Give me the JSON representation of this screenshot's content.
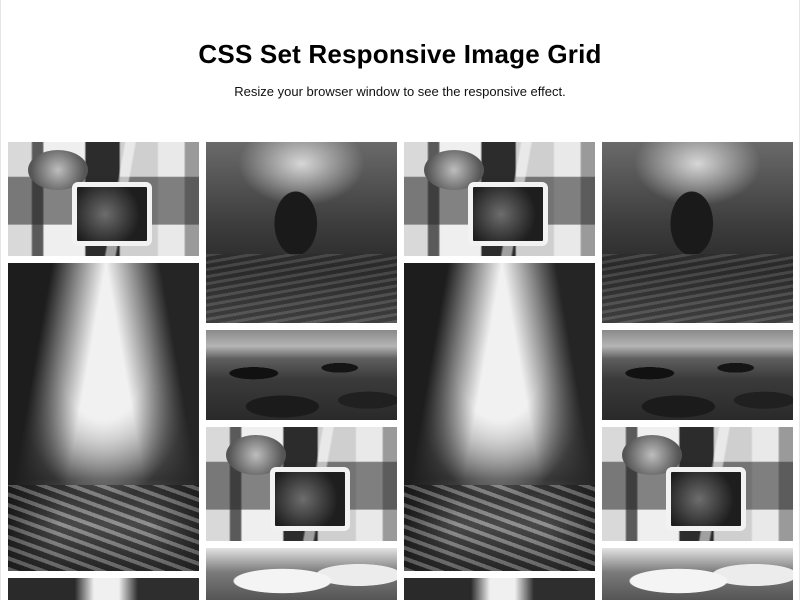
{
  "page": {
    "title": "CSS Set Responsive Image Grid",
    "subtitle": "Resize your browser window to see the responsive effect."
  },
  "grid": {
    "columns": [
      {
        "images": [
          "car",
          "canyon",
          "waterfall"
        ]
      },
      {
        "images": [
          "underwater",
          "rocks",
          "car",
          "clouds"
        ]
      },
      {
        "images": [
          "car",
          "canyon",
          "waterfall"
        ]
      },
      {
        "images": [
          "underwater",
          "rocks",
          "car",
          "clouds"
        ]
      }
    ]
  },
  "colors": {
    "background": "#ffffff",
    "text": "#000000"
  }
}
